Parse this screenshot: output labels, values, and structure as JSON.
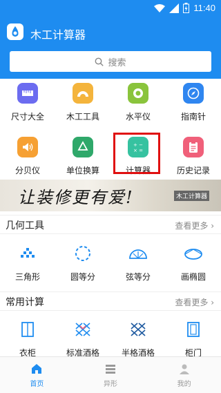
{
  "status_bar": {
    "time": "11:40"
  },
  "header": {
    "title": "木工计算器"
  },
  "search": {
    "placeholder": "搜索"
  },
  "tools_row1": [
    {
      "label": "尺寸大全",
      "icon": "ruler-icon",
      "color": "#6c6cf0"
    },
    {
      "label": "木工工具",
      "icon": "protractor-icon",
      "color": "#f4b43c"
    },
    {
      "label": "水平仪",
      "icon": "level-icon",
      "color": "#8ac43c"
    },
    {
      "label": "指南针",
      "icon": "compass-icon",
      "color": "#2f86f0"
    }
  ],
  "tools_row2": [
    {
      "label": "分贝仪",
      "icon": "speaker-icon",
      "color": "#f6a033"
    },
    {
      "label": "单位换算",
      "icon": "recycle-icon",
      "color": "#2fa86a"
    },
    {
      "label": "计算器",
      "icon": "calculator-icon",
      "color": "#36c2a0"
    },
    {
      "label": "历史记录",
      "icon": "clipboard-icon",
      "color": "#f0607a"
    }
  ],
  "banner": {
    "slogan": "让装修更有爱!",
    "tag": "木工计算器"
  },
  "geometry": {
    "title": "几何工具",
    "more": "查看更多",
    "items": [
      {
        "label": "三角形",
        "icon": "triangle-dots-icon"
      },
      {
        "label": "圆等分",
        "icon": "circle-divide-icon"
      },
      {
        "label": "弦等分",
        "icon": "chord-icon"
      },
      {
        "label": "画椭圆",
        "icon": "ellipse-icon"
      }
    ]
  },
  "common": {
    "title": "常用计算",
    "more": "查看更多",
    "items": [
      {
        "label": "衣柜",
        "icon": "wardrobe-icon"
      },
      {
        "label": "标准酒格",
        "icon": "wine-rack-icon"
      },
      {
        "label": "半格酒格",
        "icon": "half-wine-rack-icon"
      },
      {
        "label": "柜门",
        "icon": "cabinet-door-icon"
      }
    ]
  },
  "tabbar": {
    "items": [
      {
        "label": "首页",
        "icon": "home-icon",
        "active": true
      },
      {
        "label": "异形",
        "icon": "list-icon",
        "active": false
      },
      {
        "label": "我的",
        "icon": "user-icon",
        "active": false
      }
    ],
    "active_color": "#1e8cf0",
    "inactive_color": "#999999"
  }
}
